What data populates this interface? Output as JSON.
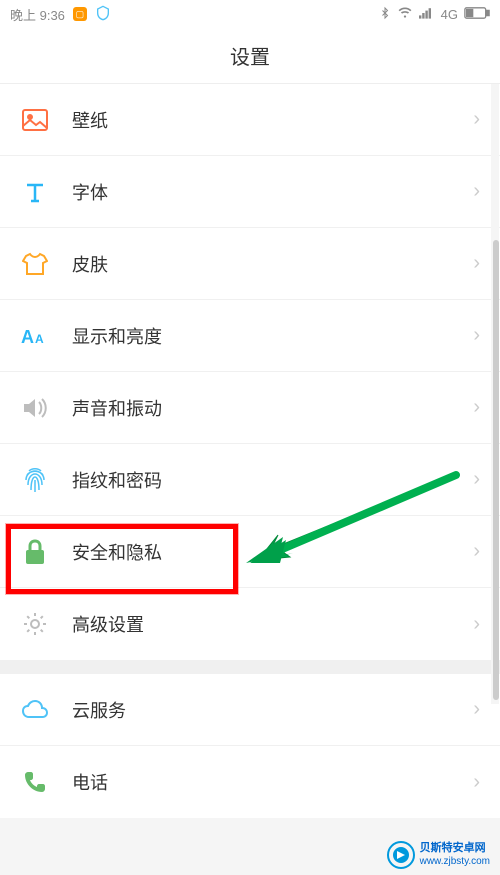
{
  "statusBar": {
    "time": "晚上 9:36",
    "network": "4G"
  },
  "header": {
    "title": "设置"
  },
  "items": [
    {
      "label": "壁纸"
    },
    {
      "label": "字体"
    },
    {
      "label": "皮肤"
    },
    {
      "label": "显示和亮度"
    },
    {
      "label": "声音和振动"
    },
    {
      "label": "指纹和密码"
    },
    {
      "label": "安全和隐私"
    },
    {
      "label": "高级设置"
    },
    {
      "label": "云服务"
    },
    {
      "label": "电话"
    }
  ],
  "watermark": {
    "name": "贝斯特安卓网",
    "url": "www.zjbsty.com"
  }
}
